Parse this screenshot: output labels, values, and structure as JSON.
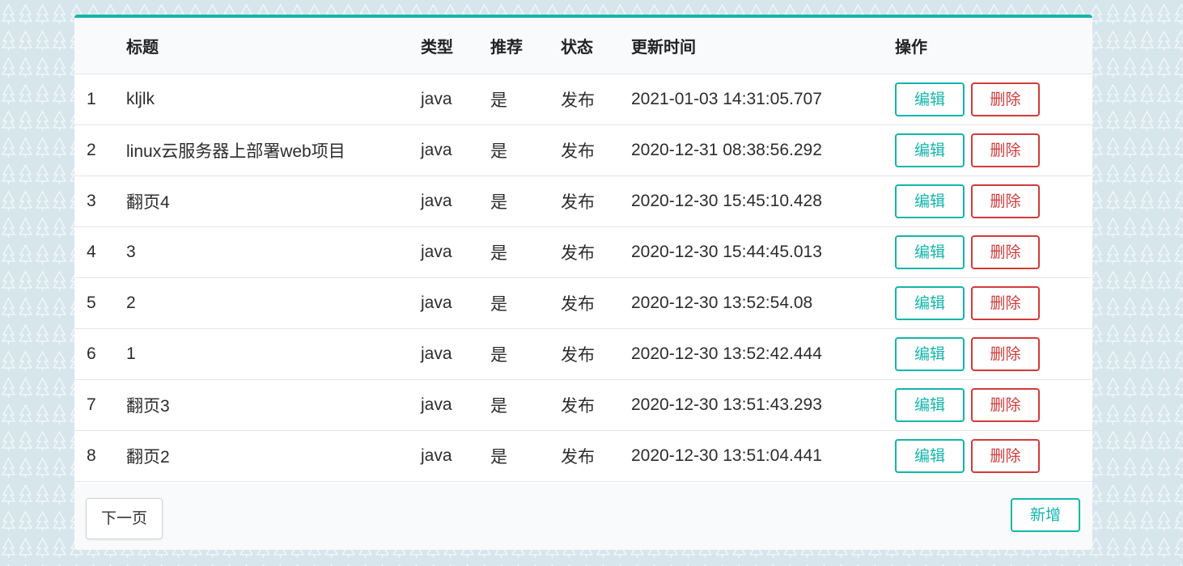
{
  "colors": {
    "accent": "#14b5ab",
    "danger": "#d33a3a",
    "background": "#d6e6ec"
  },
  "table": {
    "headers": {
      "index": "",
      "title": "标题",
      "type": "类型",
      "recommend": "推荐",
      "status": "状态",
      "updated": "更新时间",
      "actions": "操作"
    },
    "rows": [
      {
        "index": "1",
        "title": "kljlk",
        "type": "java",
        "recommend": "是",
        "status": "发布",
        "updated": "2021-01-03 14:31:05.707"
      },
      {
        "index": "2",
        "title": "linux云服务器上部署web项目",
        "type": "java",
        "recommend": "是",
        "status": "发布",
        "updated": "2020-12-31 08:38:56.292"
      },
      {
        "index": "3",
        "title": "翻页4",
        "type": "java",
        "recommend": "是",
        "status": "发布",
        "updated": "2020-12-30 15:45:10.428"
      },
      {
        "index": "4",
        "title": "3",
        "type": "java",
        "recommend": "是",
        "status": "发布",
        "updated": "2020-12-30 15:44:45.013"
      },
      {
        "index": "5",
        "title": "2",
        "type": "java",
        "recommend": "是",
        "status": "发布",
        "updated": "2020-12-30 13:52:54.08"
      },
      {
        "index": "6",
        "title": "1",
        "type": "java",
        "recommend": "是",
        "status": "发布",
        "updated": "2020-12-30 13:52:42.444"
      },
      {
        "index": "7",
        "title": "翻页3",
        "type": "java",
        "recommend": "是",
        "status": "发布",
        "updated": "2020-12-30 13:51:43.293"
      },
      {
        "index": "8",
        "title": "翻页2",
        "type": "java",
        "recommend": "是",
        "status": "发布",
        "updated": "2020-12-30 13:51:04.441"
      }
    ],
    "edit_label": "编辑",
    "delete_label": "删除"
  },
  "footer": {
    "next_label": "下一页",
    "add_label": "新增"
  }
}
